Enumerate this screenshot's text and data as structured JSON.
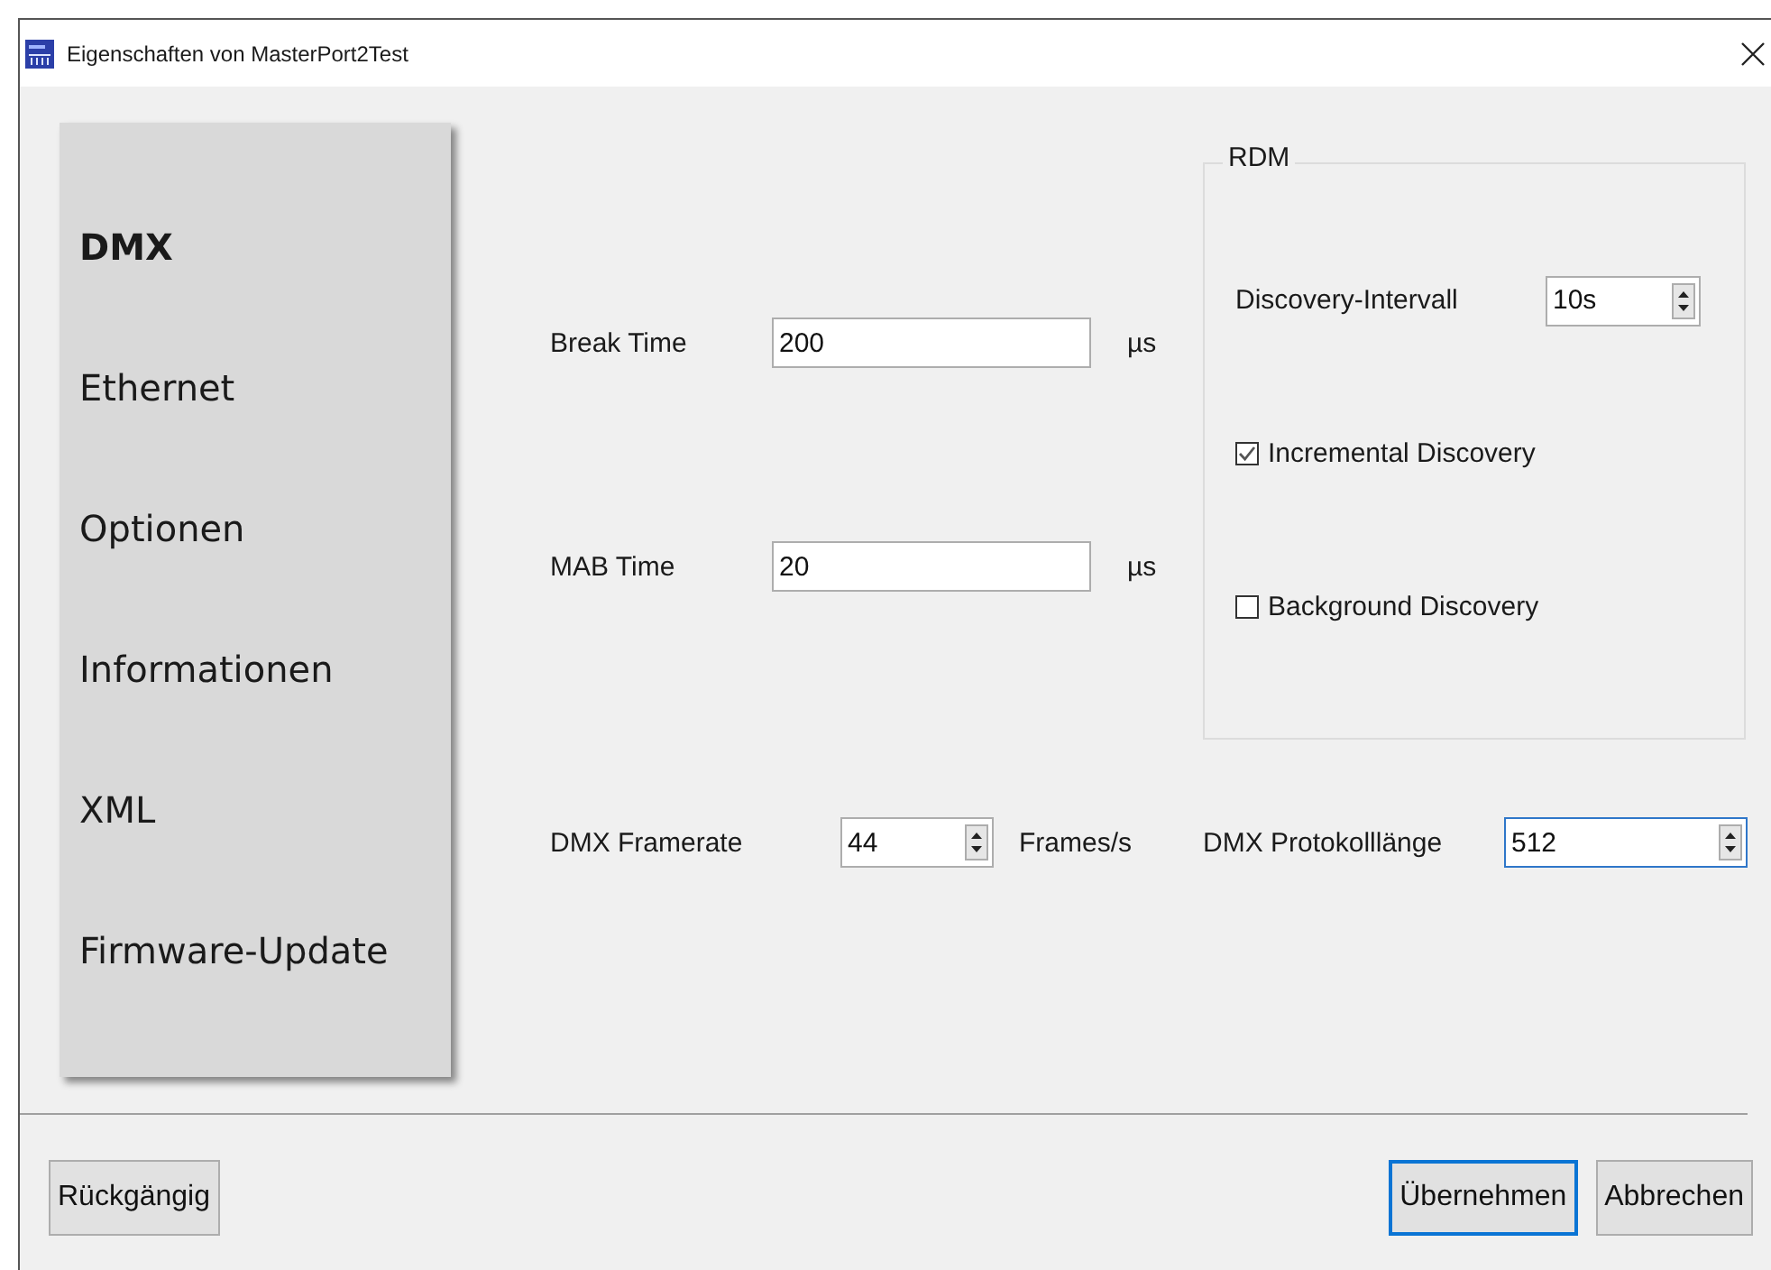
{
  "window": {
    "title": "Eigenschaften von MasterPort2Test"
  },
  "sidebar": {
    "items": [
      {
        "label": "DMX",
        "selected": true
      },
      {
        "label": "Ethernet",
        "selected": false
      },
      {
        "label": "Optionen",
        "selected": false
      },
      {
        "label": "Informationen",
        "selected": false
      },
      {
        "label": "XML",
        "selected": false
      },
      {
        "label": "Firmware-Update",
        "selected": false
      }
    ]
  },
  "timing_fields": [
    {
      "label": "Break Time",
      "value": "200",
      "unit": "µs"
    },
    {
      "label": "MAB Time",
      "value": "20",
      "unit": "µs"
    }
  ],
  "rdm": {
    "title": "RDM",
    "interval": {
      "label": "Discovery-Intervall",
      "value": "10s"
    },
    "options": [
      {
        "label": "Incremental Discovery",
        "checked": true
      },
      {
        "label": "Background Discovery",
        "checked": false
      }
    ]
  },
  "framerate": {
    "label": "DMX Framerate",
    "value": "44",
    "unit": "Frames/s",
    "focused": false
  },
  "protocol_length": {
    "label": "DMX Protokolllänge",
    "value": "512",
    "focused": true
  },
  "left_buttons": [
    {
      "label": "Rückgängig",
      "default": false
    }
  ],
  "right_buttons": [
    {
      "label": "Übernehmen",
      "default": true
    },
    {
      "label": "Abbrechen",
      "default": false
    }
  ]
}
